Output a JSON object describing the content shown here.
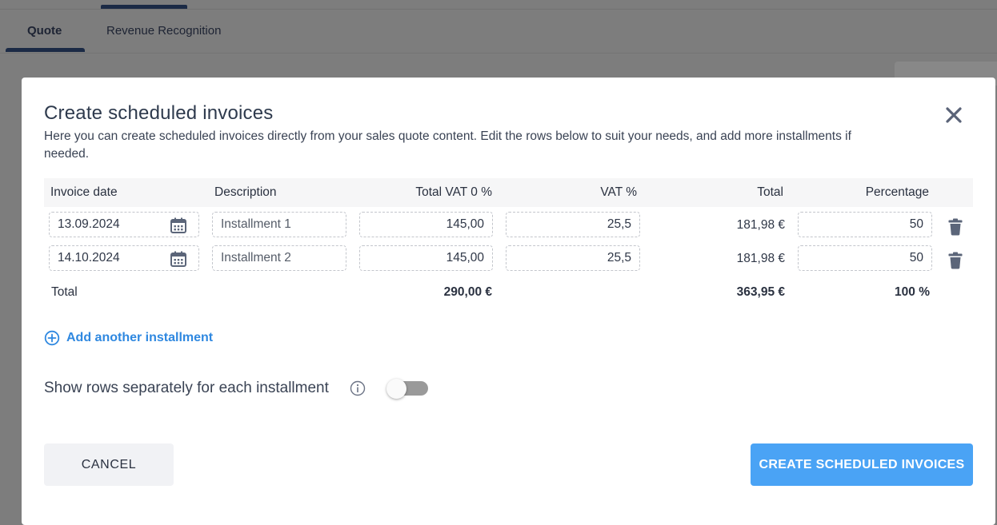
{
  "background": {
    "tabs": [
      {
        "label": "Quote"
      },
      {
        "label": "Revenue Recognition"
      }
    ]
  },
  "modal": {
    "title": "Create scheduled invoices",
    "subtitle": "Here you can create scheduled invoices directly from your sales quote content. Edit the rows below to suit your needs, and add more installments if needed.",
    "close_icon": "close-icon"
  },
  "table": {
    "headers": {
      "invoice_date": "Invoice date",
      "description": "Description",
      "total_vat0": "Total VAT 0 %",
      "vat_pct": "VAT %",
      "total": "Total",
      "percentage": "Percentage"
    },
    "rows": [
      {
        "invoice_date": "13.09.2024",
        "description": "Installment 1",
        "total_vat0": "145,00",
        "vat_pct": "25,5",
        "total": "181,98 €",
        "percentage": "50"
      },
      {
        "invoice_date": "14.10.2024",
        "description": "Installment 2",
        "total_vat0": "145,00",
        "vat_pct": "25,5",
        "total": "181,98 €",
        "percentage": "50"
      }
    ],
    "totals": {
      "label": "Total",
      "total_vat0": "290,00 €",
      "total": "363,95 €",
      "percentage": "100 %"
    }
  },
  "actions": {
    "add_installment": "Add another installment",
    "toggle_label": "Show rows separately for each installment",
    "toggle_on": false,
    "cancel": "CANCEL",
    "create": "CREATE SCHEDULED INVOICES"
  },
  "colors": {
    "accent": "#4aa3f5",
    "link": "#2f88e0",
    "overlay": "#7d7d7d"
  }
}
